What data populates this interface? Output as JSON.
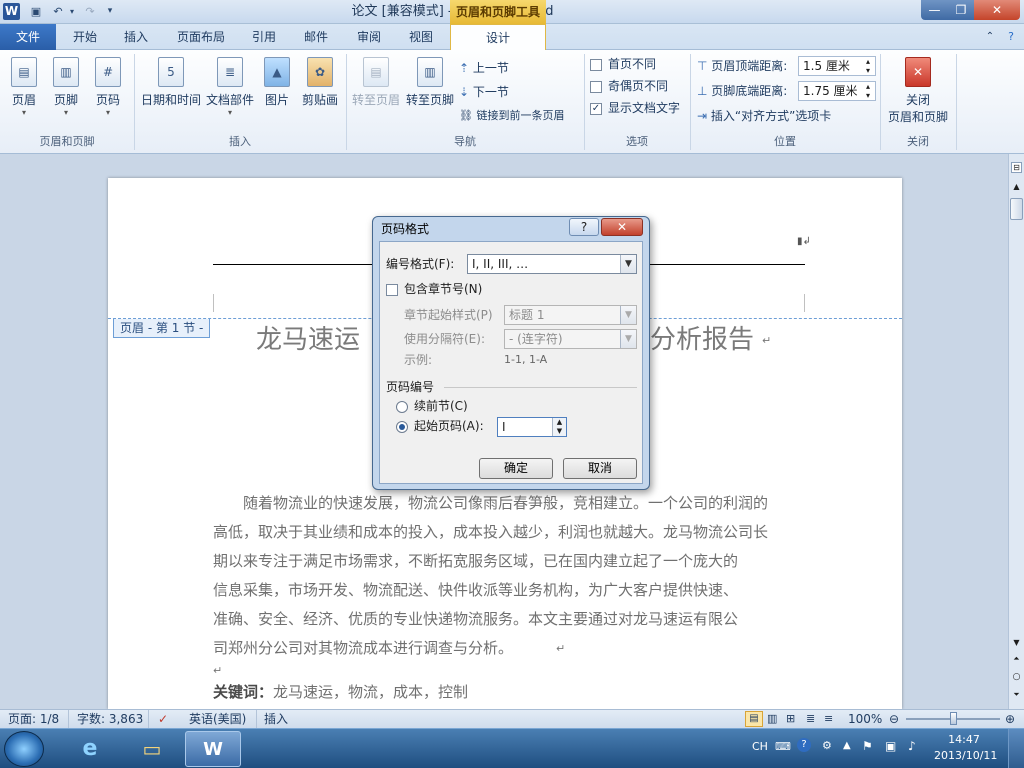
{
  "window": {
    "title": "论文 [兼容模式] - Microsoft Word",
    "context_tab_title": "页眉和页脚工具",
    "controls": {
      "minimize": "—",
      "restore": "❐",
      "close": "✕"
    }
  },
  "tabs": [
    "文件",
    "开始",
    "插入",
    "页面布局",
    "引用",
    "邮件",
    "审阅",
    "视图",
    "设计"
  ],
  "ribbon": {
    "groups": {
      "header_footer": {
        "label": "页眉和页脚",
        "buttons": [
          "页眉",
          "页脚",
          "页码"
        ]
      },
      "insert": {
        "label": "插入",
        "buttons": [
          "日期和时间",
          "文档部件",
          "图片",
          "剪贴画"
        ]
      },
      "navigation": {
        "label": "导航",
        "goto_header": "转至页眉",
        "goto_footer": "转至页脚",
        "prev": "上一节",
        "next": "下一节",
        "link_prev": "链接到前一条页眉"
      },
      "options": {
        "label": "选项",
        "diff_first": "首页不同",
        "diff_odd_even": "奇偶页不同",
        "show_doc_text": "显示文档文字"
      },
      "position": {
        "label": "位置",
        "header_top_label": "页眉顶端距离:",
        "header_top_value": "1.5 厘米",
        "footer_bottom_label": "页脚底端距离:",
        "footer_bottom_value": "1.75 厘米",
        "insert_align_tab": "插入“对齐方式”选项卡"
      },
      "close": {
        "label": "关闭",
        "button_line1": "关闭",
        "button_line2": "页眉和页脚"
      }
    }
  },
  "document": {
    "header_tag": "页眉 - 第 1 节 -",
    "heading_left": "龙马速运",
    "heading_right": "分析报告",
    "paragraph_lines": [
      "随着物流业的快速发展，物流公司像雨后春笋般，竞相建立。一个公司的利润的",
      "高低，取决于其业绩和成本的投入，成本投入越少，利润也就越大。龙马物流公司长",
      "期以来专注于满足市场需求，不断拓宽服务区域，已在国内建立起了一个庞大的",
      "信息采集，市场开发、物流配送、快件收派等业务机构，为广大客户提供快速、",
      "准确、安全、经济、优质的专业快递物流服务。本文主要通过对龙马速运有限公",
      "司郑州分公司对其物流成本进行调查与分析。"
    ],
    "keywords_label": "关键词：",
    "keywords": "龙马速运，物流，成本，控制"
  },
  "dialog": {
    "title": "页码格式",
    "number_format_label": "编号格式(F):",
    "number_format_value": "I, II, III, …",
    "include_chapter_label": "包含章节号(N)",
    "chapter_style_label": "章节起始样式(P)",
    "chapter_style_value": "标题 1",
    "separator_label": "使用分隔符(E):",
    "separator_value": "-  (连字符)",
    "example_label": "示例:",
    "example_value": "1-1, 1-A",
    "page_numbering_label": "页码编号",
    "continue_label": "续前节(C)",
    "start_at_label": "起始页码(A):",
    "start_at_value": "I",
    "ok": "确定",
    "cancel": "取消"
  },
  "statusbar": {
    "page": "页面: 1/8",
    "words": "字数: 3,863",
    "language": "英语(美国)",
    "mode": "插入",
    "zoom": "100%"
  },
  "taskbar": {
    "ime": "CH",
    "time": "14:47",
    "date": "2013/10/11"
  }
}
